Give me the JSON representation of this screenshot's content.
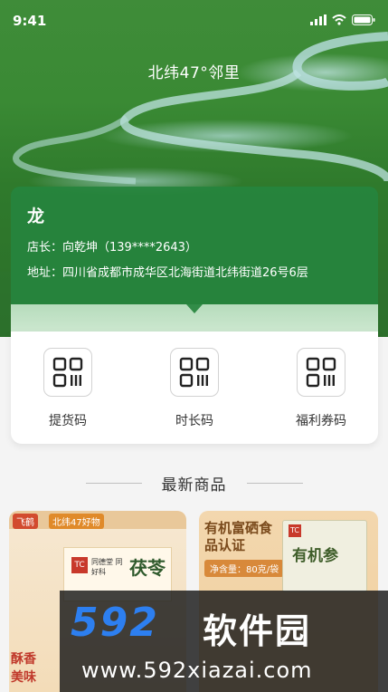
{
  "status_bar": {
    "time": "9:41"
  },
  "header": {
    "title": "北纬47°邻里"
  },
  "store": {
    "name": "龙",
    "manager_label": "店长：",
    "manager_value": "向乾坤（139****2643）",
    "address_label": "地址：",
    "address_value": "四川省成都市成华区北海街道北纬街道26号6层"
  },
  "codes": [
    {
      "label": "提货码",
      "icon": "qr-code-icon"
    },
    {
      "label": "时长码",
      "icon": "qr-code-icon"
    },
    {
      "label": "福利券码",
      "icon": "qr-code-icon"
    }
  ],
  "section": {
    "title": "最新商品"
  },
  "products": [
    {
      "tag": "飞鹤",
      "tag2": "北纬47好物",
      "box_name": "茯苓",
      "box_logo": "TC",
      "box_sub": "同德堂 同好科",
      "side_text": "酥香美味"
    },
    {
      "headline": "有机富硒食品认证",
      "spec": "净含量：80克/袋",
      "pack_name": "有机参",
      "pack_logo": "TC"
    }
  ],
  "watermark": {
    "brand": "592",
    "brand_cn": "软件园",
    "url": "www.592xiazai.com"
  },
  "colors": {
    "card_green": "#26843e",
    "watermark_blue": "#2d7ff0"
  }
}
